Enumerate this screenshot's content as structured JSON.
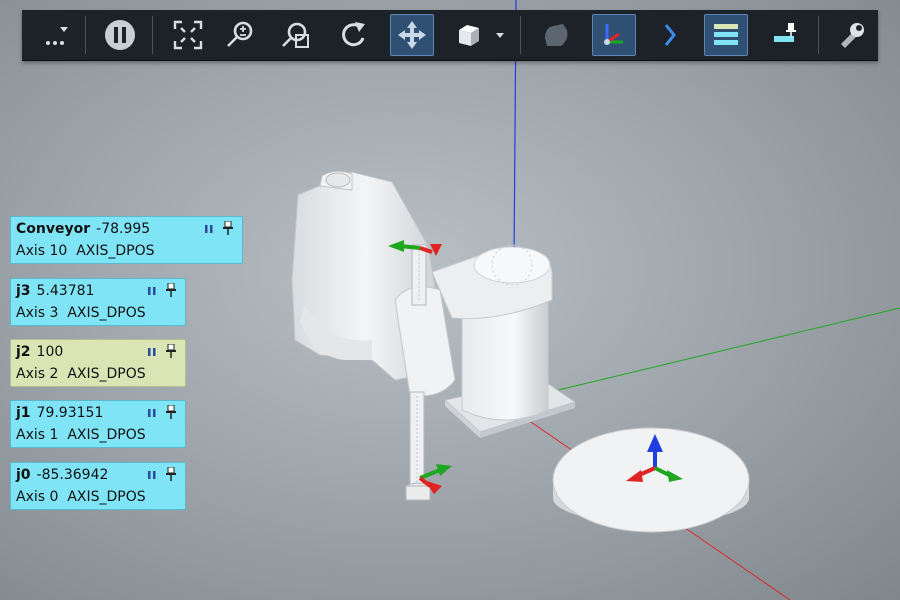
{
  "toolbar": {
    "buttons": [
      {
        "name": "more-options-icon"
      },
      {
        "name": "pause-icon"
      },
      {
        "name": "fit-view-icon"
      },
      {
        "name": "zoom-icon"
      },
      {
        "name": "zoom-window-icon"
      },
      {
        "name": "rotate-view-icon"
      },
      {
        "name": "move-icon",
        "active": true
      },
      {
        "name": "cube-view-icon"
      },
      {
        "name": "object-icon"
      },
      {
        "name": "axes-icon",
        "active": true
      },
      {
        "name": "chevron-right-icon"
      },
      {
        "name": "list-panel-icon",
        "active": true
      },
      {
        "name": "pin-panel-icon"
      },
      {
        "name": "tool-icon"
      }
    ]
  },
  "axis_cards": [
    {
      "id": "conveyor",
      "name": "Conveyor",
      "value": "-78.995",
      "axis": "Axis 10",
      "mode": "AXIS_DPOS",
      "highlighted": false
    },
    {
      "id": "j3",
      "name": "j3",
      "value": "5.43781",
      "axis": "Axis 3",
      "mode": "AXIS_DPOS",
      "highlighted": false
    },
    {
      "id": "j2",
      "name": "j2",
      "value": "100",
      "axis": "Axis 2",
      "mode": "AXIS_DPOS",
      "highlighted": true
    },
    {
      "id": "j1",
      "name": "j1",
      "value": "79.93151",
      "axis": "Axis 1",
      "mode": "AXIS_DPOS",
      "highlighted": false
    },
    {
      "id": "j0",
      "name": "j0",
      "value": "-85.36942",
      "axis": "Axis 0",
      "mode": "AXIS_DPOS",
      "highlighted": false
    }
  ],
  "colors": {
    "card_bg": "#80e4f7",
    "card_highlight_bg": "#d9e5b5",
    "toolbar_bg": "#1d2228",
    "axis_x": "#e02424",
    "axis_y": "#1fa71f",
    "axis_z": "#1f3de0",
    "active_button": "#2f4f73"
  }
}
